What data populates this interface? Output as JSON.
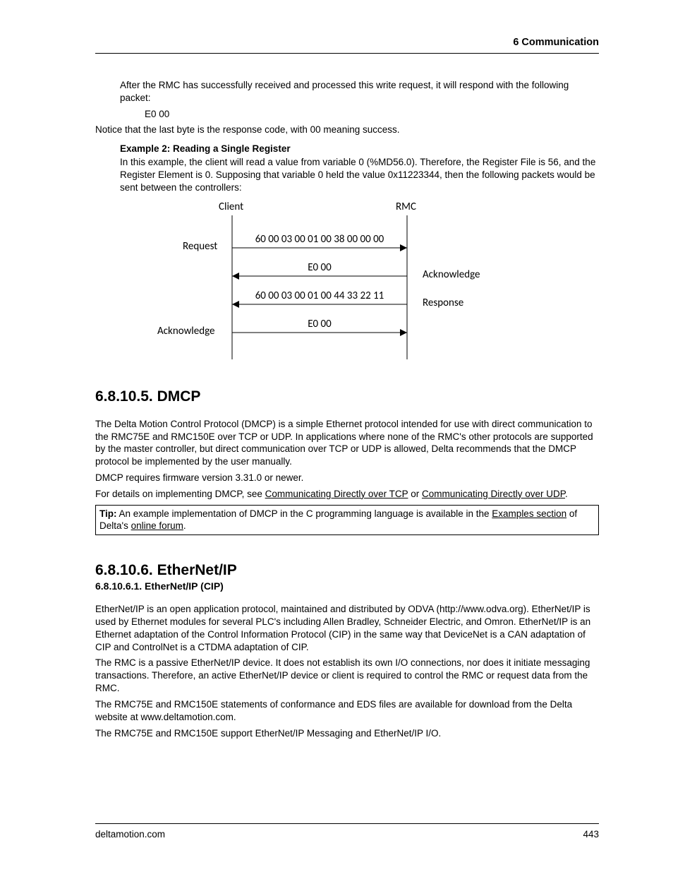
{
  "header": {
    "chapter": "6  Communication"
  },
  "footer": {
    "site": "deltamotion.com",
    "page": "443"
  },
  "p1": "After the RMC has successfully received and processed this write request, it will respond with the following packet:",
  "packet1": "E0 00",
  "p2": "Notice that the last byte is the response code, with 00 meaning success.",
  "ex2_head": "Example 2: Reading a Single Register",
  "ex2_body": "In this example, the client will read a value from variable 0 (%MD56.0). Therefore, the Register File is 56, and the Register Element is 0. Supposing that variable 0 held the value 0x11223344, then the following packets would be sent between the controllers:",
  "diagram": {
    "client": "Client",
    "rmc": "RMC",
    "request": "Request",
    "ack": "Acknowledge",
    "response": "Response",
    "row1": "60 00 03 00 01 00 38 00 00 00",
    "row2": "E0 00",
    "row3": "60 00 03 00 01 00 44 33 22 11",
    "row4": "E0 00"
  },
  "sec5_title": "6.8.10.5. DMCP",
  "sec5_p1": "The Delta Motion Control Protocol (DMCP) is a simple Ethernet protocol intended for use with direct communication to the RMC75E and RMC150E over TCP or UDP. In applications where none of the RMC's other protocols are supported by the master controller, but direct communication over TCP or UDP is allowed, Delta recommends that the DMCP protocol be implemented by the user manually.",
  "sec5_p2": "DMCP requires firmware version 3.31.0 or newer.",
  "sec5_p3a": "For details on implementing DMCP, see ",
  "sec5_link1": "Communicating Directly over TCP",
  "sec5_or": " or ",
  "sec5_link2": "Communicating Directly over UDP",
  "sec5_period": ".",
  "tip_label": "Tip:",
  "tip_a": " An example implementation of DMCP in the C programming language is available in the ",
  "tip_link1": "Examples section",
  "tip_b": " of Delta's ",
  "tip_link2": "online forum",
  "tip_c": ".",
  "sec6_title": "6.8.10.6. EtherNet/IP",
  "sec6_sub": "6.8.10.6.1. EtherNet/IP (CIP)",
  "sec6_p1": "EtherNet/IP is an open application protocol, maintained and distributed by ODVA (http://www.odva.org). EtherNet/IP is used by Ethernet modules for several PLC's including Allen Bradley, Schneider Electric, and Omron. EtherNet/IP is an Ethernet adaptation of the Control Information Protocol (CIP) in the same way that DeviceNet is a CAN adaptation of CIP and ControlNet is a CTDMA adaptation of CIP.",
  "sec6_p2": "The RMC is a passive EtherNet/IP device. It does not establish its own I/O connections, nor does it initiate messaging transactions. Therefore, an active EtherNet/IP device or client is required to control the RMC or request data from the RMC.",
  "sec6_p3": "The RMC75E and RMC150E statements of conformance and EDS files are available for download from the Delta website at www.deltamotion.com.",
  "sec6_p4": "The RMC75E and RMC150E support EtherNet/IP Messaging and EtherNet/IP I/O."
}
